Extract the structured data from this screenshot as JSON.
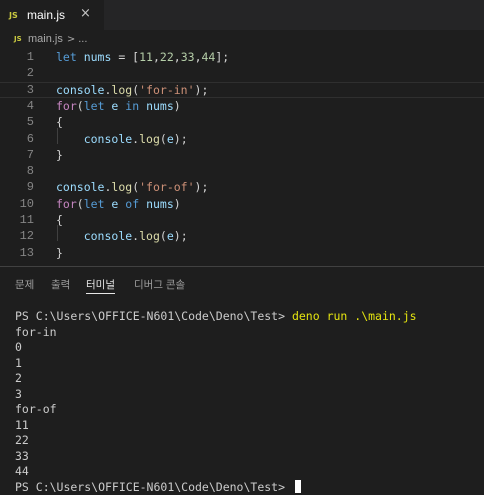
{
  "tab": {
    "badge": "JS",
    "title": "main.js",
    "close_icon": "×"
  },
  "breadcrumb": {
    "badge": "JS",
    "file": "main.js",
    "separator": ">",
    "tail": "..."
  },
  "editor": {
    "lines": [
      {
        "n": "1",
        "tokens": [
          {
            "t": "let ",
            "c": "#569cd6"
          },
          {
            "t": "nums",
            "c": "#9cdcfe"
          },
          {
            "t": " = [",
            "c": "#d4d4d4"
          },
          {
            "t": "11",
            "c": "#b5cea8"
          },
          {
            "t": ",",
            "c": "#d4d4d4"
          },
          {
            "t": "22",
            "c": "#b5cea8"
          },
          {
            "t": ",",
            "c": "#d4d4d4"
          },
          {
            "t": "33",
            "c": "#b5cea8"
          },
          {
            "t": ",",
            "c": "#d4d4d4"
          },
          {
            "t": "44",
            "c": "#b5cea8"
          },
          {
            "t": "];",
            "c": "#d4d4d4"
          }
        ]
      },
      {
        "n": "2",
        "tokens": []
      },
      {
        "n": "3",
        "current": true,
        "tokens": [
          {
            "t": "console",
            "c": "#9cdcfe"
          },
          {
            "t": ".",
            "c": "#d4d4d4"
          },
          {
            "t": "log",
            "c": "#dcdcaa"
          },
          {
            "t": "(",
            "c": "#d4d4d4"
          },
          {
            "t": "'for-in'",
            "c": "#ce9178"
          },
          {
            "t": ");",
            "c": "#d4d4d4"
          }
        ]
      },
      {
        "n": "4",
        "tokens": [
          {
            "t": "for",
            "c": "#c586c0"
          },
          {
            "t": "(",
            "c": "#d4d4d4"
          },
          {
            "t": "let ",
            "c": "#569cd6"
          },
          {
            "t": "e ",
            "c": "#9cdcfe"
          },
          {
            "t": "in ",
            "c": "#569cd6"
          },
          {
            "t": "nums",
            "c": "#9cdcfe"
          },
          {
            "t": ")",
            "c": "#d4d4d4"
          }
        ]
      },
      {
        "n": "5",
        "tokens": [
          {
            "t": "{",
            "c": "#d4d4d4"
          }
        ]
      },
      {
        "n": "6",
        "tokens": [
          {
            "t": "    ",
            "c": "#d4d4d4"
          },
          {
            "t": "console",
            "c": "#9cdcfe"
          },
          {
            "t": ".",
            "c": "#d4d4d4"
          },
          {
            "t": "log",
            "c": "#dcdcaa"
          },
          {
            "t": "(",
            "c": "#d4d4d4"
          },
          {
            "t": "e",
            "c": "#9cdcfe"
          },
          {
            "t": ");",
            "c": "#d4d4d4"
          }
        ]
      },
      {
        "n": "7",
        "tokens": [
          {
            "t": "}",
            "c": "#d4d4d4"
          }
        ]
      },
      {
        "n": "8",
        "tokens": []
      },
      {
        "n": "9",
        "tokens": [
          {
            "t": "console",
            "c": "#9cdcfe"
          },
          {
            "t": ".",
            "c": "#d4d4d4"
          },
          {
            "t": "log",
            "c": "#dcdcaa"
          },
          {
            "t": "(",
            "c": "#d4d4d4"
          },
          {
            "t": "'for-of'",
            "c": "#ce9178"
          },
          {
            "t": ");",
            "c": "#d4d4d4"
          }
        ]
      },
      {
        "n": "10",
        "tokens": [
          {
            "t": "for",
            "c": "#c586c0"
          },
          {
            "t": "(",
            "c": "#d4d4d4"
          },
          {
            "t": "let ",
            "c": "#569cd6"
          },
          {
            "t": "e ",
            "c": "#9cdcfe"
          },
          {
            "t": "of ",
            "c": "#569cd6"
          },
          {
            "t": "nums",
            "c": "#9cdcfe"
          },
          {
            "t": ")",
            "c": "#d4d4d4"
          }
        ]
      },
      {
        "n": "11",
        "tokens": [
          {
            "t": "{",
            "c": "#d4d4d4"
          }
        ]
      },
      {
        "n": "12",
        "tokens": [
          {
            "t": "    ",
            "c": "#d4d4d4"
          },
          {
            "t": "console",
            "c": "#9cdcfe"
          },
          {
            "t": ".",
            "c": "#d4d4d4"
          },
          {
            "t": "log",
            "c": "#dcdcaa"
          },
          {
            "t": "(",
            "c": "#d4d4d4"
          },
          {
            "t": "e",
            "c": "#9cdcfe"
          },
          {
            "t": ");",
            "c": "#d4d4d4"
          }
        ]
      },
      {
        "n": "13",
        "tokens": [
          {
            "t": "}",
            "c": "#d4d4d4"
          }
        ]
      }
    ]
  },
  "panel": {
    "tabs": [
      {
        "label": "문제",
        "active": false
      },
      {
        "label": "출력",
        "active": false
      },
      {
        "label": "터미널",
        "active": true
      },
      {
        "label": "디버그 콘솔",
        "active": false
      }
    ]
  },
  "terminal": {
    "prompt": "PS C:\\Users\\OFFICE-N601\\Code\\Deno\\Test> ",
    "command": "deno run .\\main.js",
    "output": [
      "for-in",
      "0",
      "1",
      "2",
      "3",
      "for-of",
      "11",
      "22",
      "33",
      "44"
    ],
    "final_prompt": "PS C:\\Users\\OFFICE-N601\\Code\\Deno\\Test> "
  }
}
